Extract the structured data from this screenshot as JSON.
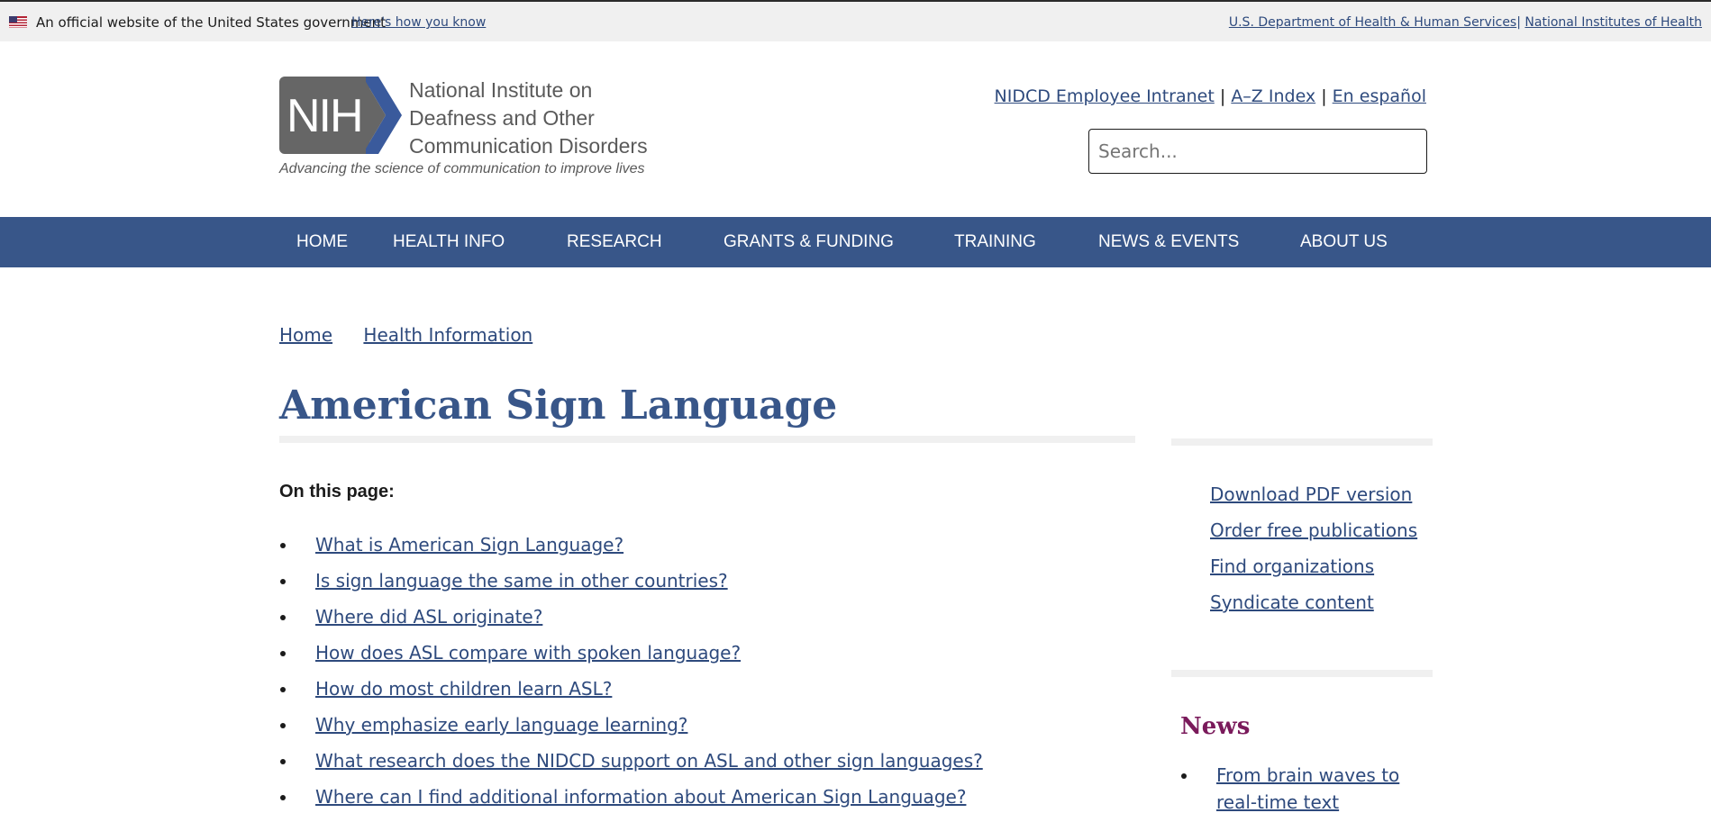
{
  "gov_banner": {
    "text": "An official website of the United States government",
    "how_link": "Here's how you know",
    "hhs_link": "U.S. Department of Health & Human Services",
    "separator": "|",
    "nih_link": "National Institutes of Health"
  },
  "logo": {
    "mark": "NIH",
    "name_line1": "National Institute on",
    "name_line2": "Deafness and Other",
    "name_line3": "Communication Disorders",
    "tagline": "Advancing the science of communication to improve lives"
  },
  "utility": {
    "intranet": "NIDCD Employee Intranet",
    "az_index": "A–Z Index",
    "spanish": "En español",
    "separator": "|"
  },
  "search": {
    "placeholder": "Search..."
  },
  "nav": {
    "items": [
      "HOME",
      "HEALTH INFO",
      "RESEARCH",
      "GRANTS & FUNDING",
      "TRAINING",
      "NEWS & EVENTS",
      "ABOUT US"
    ]
  },
  "breadcrumb": {
    "items": [
      "Home",
      "Health Information"
    ]
  },
  "page": {
    "title": "American Sign Language",
    "on_this_page": "On this page:",
    "toc": [
      "What is American Sign Language?",
      "Is sign language the same in other countries?",
      "Where did ASL originate?",
      "How does ASL compare with spoken language?",
      "How do most children learn ASL?",
      "Why emphasize early language learning?",
      "What research does the NIDCD support on ASL and other sign languages?",
      "Where can I find additional information about American Sign Language?"
    ]
  },
  "sidebar": {
    "links": [
      "Download PDF version",
      "Order free publications",
      "Find organizations",
      "Syndicate content"
    ],
    "news_title": "News",
    "news_items": [
      "From brain waves to real-time text"
    ]
  },
  "colors": {
    "nav_bg": "#385689",
    "link": "#2e4a7d",
    "title": "#385689",
    "news_heading": "#7a1a5b"
  }
}
